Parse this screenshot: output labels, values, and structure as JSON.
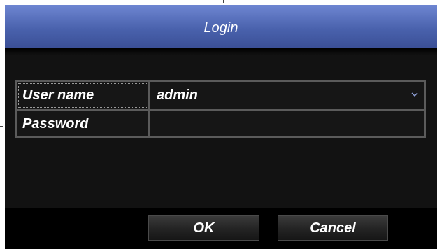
{
  "dialog": {
    "title": "Login"
  },
  "form": {
    "username": {
      "label": "User name",
      "value": "admin",
      "icon": "chevron-down-icon"
    },
    "password": {
      "label": "Password",
      "value": ""
    }
  },
  "buttons": {
    "ok_label": "OK",
    "cancel_label": "Cancel"
  },
  "colors": {
    "title_bar": "#4a62ad",
    "background": "#121212",
    "grid_border": "#5b5b5b",
    "text": "#ffffff"
  }
}
